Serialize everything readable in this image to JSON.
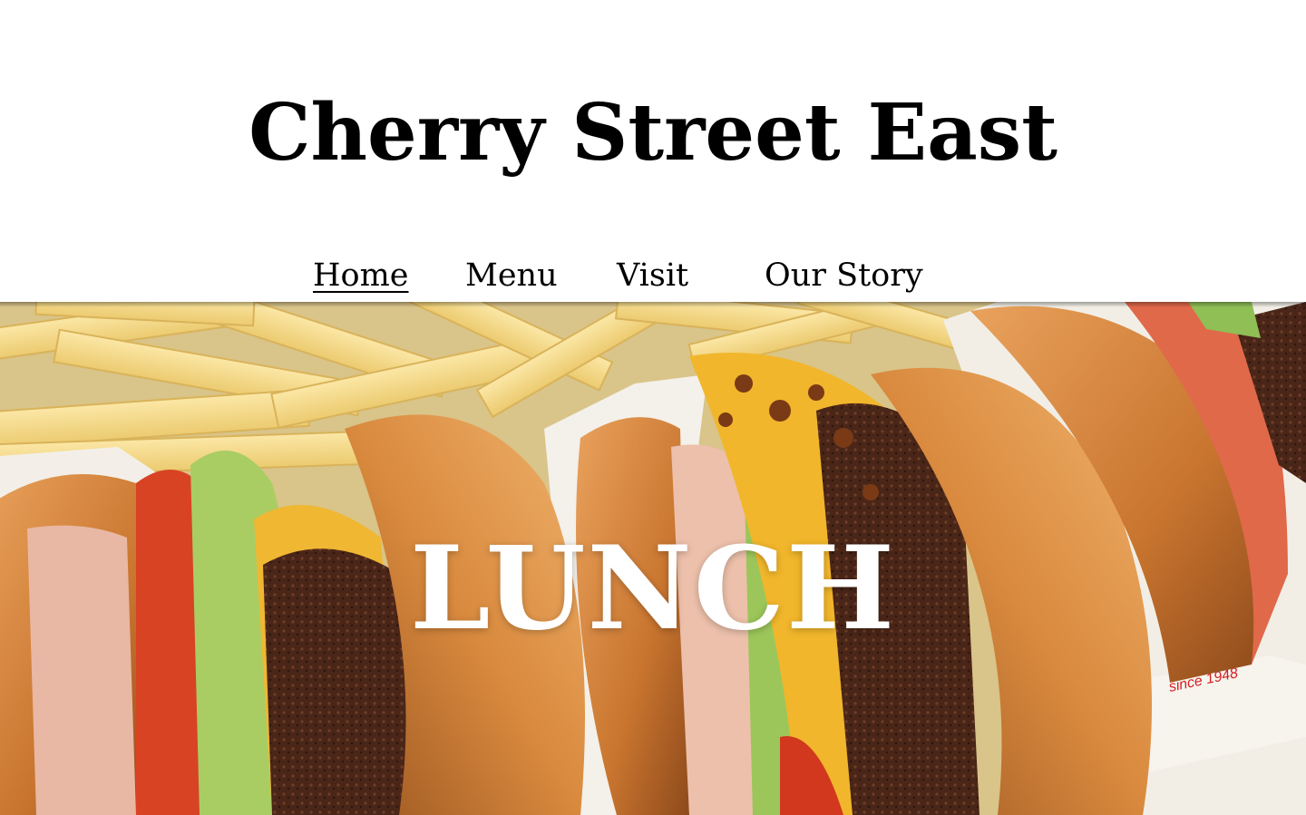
{
  "site": {
    "title": "Cherry Street East"
  },
  "nav": {
    "items": [
      {
        "label": "Home",
        "active": true
      },
      {
        "label": "Menu",
        "active": false
      },
      {
        "label": "Visit",
        "active": false
      },
      {
        "label": "Our Story",
        "active": false
      }
    ]
  },
  "hero": {
    "heading": "LUNCH",
    "image_subject": "burgers-and-fries-photo",
    "wrapper_text": "since 1948"
  },
  "colors": {
    "background": "#ffffff",
    "text": "#000000",
    "hero_text": "#ffffff"
  }
}
